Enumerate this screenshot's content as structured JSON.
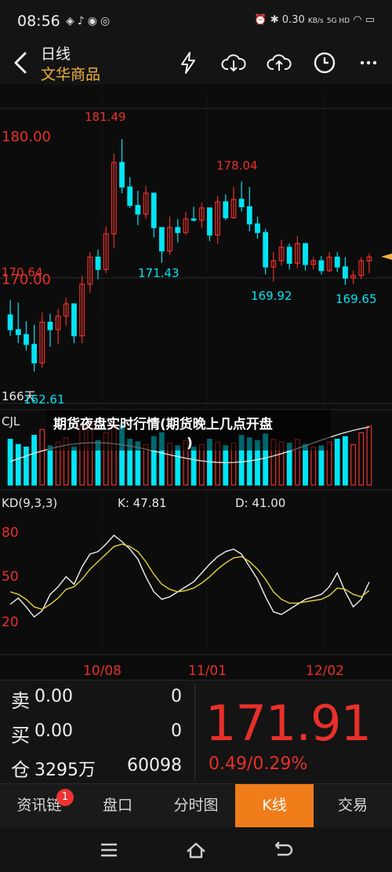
{
  "status": {
    "time": "08:56",
    "left_icons": [
      "baidu-icon",
      "tiktok-icon",
      "map-pin-icon",
      "wechat-icon"
    ],
    "net_speed": "0.30",
    "net_unit": "KB/s",
    "signal": "5G HD",
    "battery_icon": "battery-icon"
  },
  "header": {
    "title": "日线",
    "subtitle": "文华商品",
    "icons": [
      "lightning-icon",
      "cloud-download-icon",
      "cloud-upload-icon",
      "clock-icon",
      "more-icon"
    ]
  },
  "chart": {
    "price_labels": [
      "180.00",
      "170.64",
      "170.00",
      "166天"
    ],
    "annotations": [
      "181.49",
      "178.04",
      "171.43",
      "169.92",
      "169.65",
      "162.61"
    ],
    "cjl_label": "CJL",
    "overlay_text": "期货夜盘实时行情(期货晚上几点开盘)",
    "kd_label": "KD(9,3,3)",
    "k_value": "K: 47.81",
    "d_value": "D: 41.00",
    "kd_scale": [
      "80",
      "50",
      "20"
    ],
    "dates": [
      "10/08",
      "11/01",
      "12/02"
    ]
  },
  "chart_data": {
    "type": "candlestick",
    "title": "日线",
    "candles": [
      [
        167.2,
        168.4,
        165.5,
        166.0
      ],
      [
        166.0,
        168.2,
        164.9,
        165.6
      ],
      [
        165.6,
        166.7,
        164.3,
        164.8
      ],
      [
        164.8,
        166.4,
        162.6,
        163.3
      ],
      [
        163.3,
        167.4,
        162.9,
        166.6
      ],
      [
        166.6,
        167.3,
        164.6,
        166.0
      ],
      [
        166.0,
        167.7,
        164.8,
        167.1
      ],
      [
        167.1,
        168.6,
        166.3,
        168.1
      ],
      [
        168.1,
        167.4,
        164.9,
        165.5
      ],
      [
        165.5,
        170.4,
        164.9,
        169.7
      ],
      [
        169.7,
        172.3,
        169.0,
        171.9
      ],
      [
        171.9,
        172.5,
        170.1,
        170.9
      ],
      [
        170.9,
        174.4,
        170.6,
        173.8
      ],
      [
        173.8,
        180.3,
        172.6,
        179.6
      ],
      [
        179.6,
        181.49,
        177.1,
        177.6
      ],
      [
        177.6,
        178.4,
        175.9,
        176.1
      ],
      [
        176.1,
        177.3,
        174.5,
        175.4
      ],
      [
        175.4,
        177.7,
        175.0,
        177.1
      ],
      [
        177.1,
        176.8,
        173.5,
        174.3
      ],
      [
        174.3,
        174.2,
        171.43,
        172.4
      ],
      [
        172.4,
        175.2,
        172.1,
        174.3
      ],
      [
        174.3,
        175.0,
        173.1,
        173.9
      ],
      [
        173.9,
        175.6,
        173.7,
        175.0
      ],
      [
        175.0,
        176.0,
        174.8,
        174.9
      ],
      [
        174.9,
        176.3,
        174.3,
        175.9
      ],
      [
        175.9,
        175.8,
        173.2,
        173.7
      ],
      [
        173.7,
        176.9,
        173.0,
        176.4
      ],
      [
        176.4,
        177.0,
        174.9,
        175.1
      ],
      [
        175.1,
        177.6,
        175.0,
        176.6
      ],
      [
        176.6,
        178.04,
        175.6,
        176.0
      ],
      [
        176.0,
        177.6,
        174.0,
        174.6
      ],
      [
        174.6,
        175.2,
        173.4,
        173.9
      ],
      [
        173.9,
        174.2,
        170.5,
        171.1
      ],
      [
        171.1,
        172.3,
        169.92,
        171.6
      ],
      [
        171.6,
        173.3,
        171.2,
        172.7
      ],
      [
        172.7,
        173.0,
        170.9,
        171.4
      ],
      [
        171.4,
        173.6,
        171.0,
        173.0
      ],
      [
        173.0,
        172.9,
        170.8,
        171.3
      ],
      [
        171.3,
        171.9,
        170.9,
        171.6
      ],
      [
        171.6,
        172.0,
        170.5,
        170.8
      ],
      [
        170.8,
        172.3,
        170.7,
        171.9
      ],
      [
        171.9,
        172.3,
        170.7,
        171.1
      ],
      [
        171.1,
        171.9,
        169.65,
        170.2
      ],
      [
        170.2,
        170.8,
        169.7,
        170.4
      ],
      [
        170.4,
        171.9,
        170.1,
        171.6
      ],
      [
        171.6,
        172.2,
        170.6,
        171.91
      ]
    ],
    "volume": [
      70,
      62,
      58,
      76,
      85,
      60,
      66,
      72,
      58,
      90,
      95,
      68,
      80,
      96,
      92,
      70,
      66,
      62,
      74,
      80,
      64,
      60,
      68,
      58,
      62,
      70,
      66,
      60,
      64,
      76,
      72,
      68,
      78,
      70,
      66,
      64,
      70,
      62,
      58,
      60,
      66,
      70,
      74,
      62,
      80,
      90
    ],
    "kd_k": [
      30,
      35,
      28,
      20,
      25,
      38,
      44,
      52,
      46,
      60,
      70,
      72,
      78,
      85,
      80,
      74,
      66,
      52,
      40,
      34,
      36,
      40,
      44,
      48,
      55,
      62,
      68,
      72,
      74,
      70,
      60,
      50,
      36,
      24,
      22,
      26,
      30,
      34,
      36,
      38,
      44,
      55,
      40,
      28,
      34,
      47.81
    ],
    "kd_d": [
      40,
      38,
      34,
      28,
      26,
      30,
      35,
      42,
      44,
      50,
      58,
      64,
      70,
      76,
      78,
      76,
      72,
      64,
      54,
      46,
      42,
      40,
      41,
      43,
      47,
      52,
      58,
      63,
      67,
      68,
      64,
      58,
      50,
      40,
      34,
      31,
      31,
      32,
      33,
      34,
      37,
      43,
      42,
      38,
      36,
      41.0
    ],
    "ylim": [
      160,
      184
    ],
    "x_ticks": [
      "10/08",
      "11/01",
      "12/02"
    ]
  },
  "quote": {
    "sell_label": "卖",
    "sell_price": "0.00",
    "sell_vol": "0",
    "buy_label": "买",
    "buy_price": "0.00",
    "buy_vol": "0",
    "pos_label": "仓",
    "position": "3295万",
    "pos_vol": "60098",
    "last_price": "171.91",
    "change": "0.49/0.29%"
  },
  "tabs": {
    "items": [
      "资讯链",
      "盘口",
      "分时图",
      "K线",
      "交易"
    ],
    "badge": "1",
    "active": "K线"
  },
  "colors": {
    "up": "#e8302a",
    "down": "#00e5f5",
    "accent": "#f07d1a",
    "k_line": "#f0f0f0",
    "d_line": "#e6d23a"
  }
}
